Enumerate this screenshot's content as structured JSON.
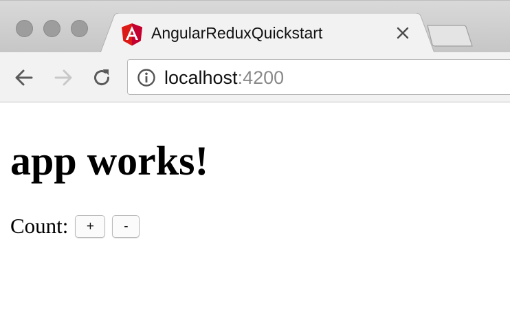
{
  "browser": {
    "tab": {
      "title": "AngularReduxQuickstart",
      "favicon": "angular-logo-icon",
      "close_icon": "close-icon"
    },
    "address_bar": {
      "host": "localhost",
      "port": ":4200",
      "icon": "info-icon"
    },
    "nav": {
      "back_icon": "back-arrow-icon",
      "forward_icon": "forward-arrow-icon",
      "reload_icon": "reload-icon"
    },
    "colors": {
      "angular_red": "#dd1b16",
      "angular_dark_red": "#c3002f"
    }
  },
  "page": {
    "title": "app works!",
    "counter": {
      "label": "Count:",
      "increment_label": "+",
      "decrement_label": "-"
    }
  }
}
